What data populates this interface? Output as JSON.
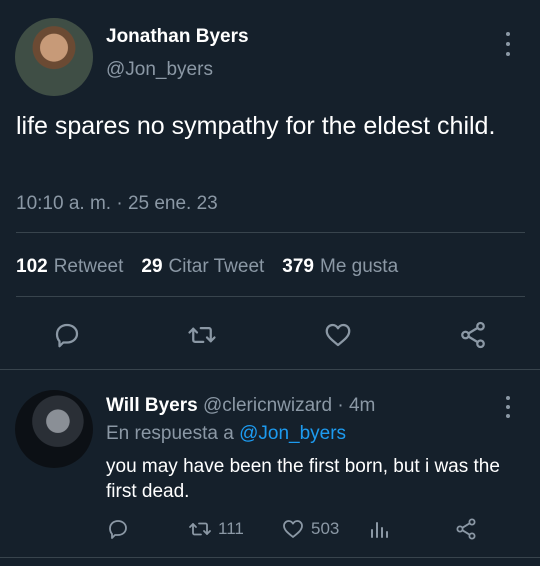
{
  "main_tweet": {
    "author_name": "Jonathan Byers",
    "author_handle": "@Jon_byers",
    "text": "life spares no sympathy for the eldest child.",
    "timestamp": "10:10 a. m. · 25 ene. 23",
    "stats": {
      "retweets_count": "102",
      "retweets_label": "Retweet",
      "quotes_count": "29",
      "quotes_label": "Citar Tweet",
      "likes_count": "379",
      "likes_label": "Me gusta"
    }
  },
  "reply": {
    "author_name": "Will Byers",
    "author_handle": "@clericnwizard",
    "separator": "·",
    "time": "4m",
    "in_reply_prefix": "En respuesta a",
    "in_reply_mention": "@Jon_byers",
    "text": "you may have been the first born, but i was the first dead.",
    "retweets": "111",
    "likes": "503"
  },
  "icons": {
    "reply": "reply-icon",
    "retweet": "retweet-icon",
    "like": "heart-icon",
    "share": "share-icon",
    "analytics": "analytics-icon",
    "menu": "more-vertical-icon"
  },
  "colors": {
    "background": "#15202b",
    "muted": "#8b98a5",
    "accent": "#1d9bf0",
    "divider": "#38444d"
  }
}
